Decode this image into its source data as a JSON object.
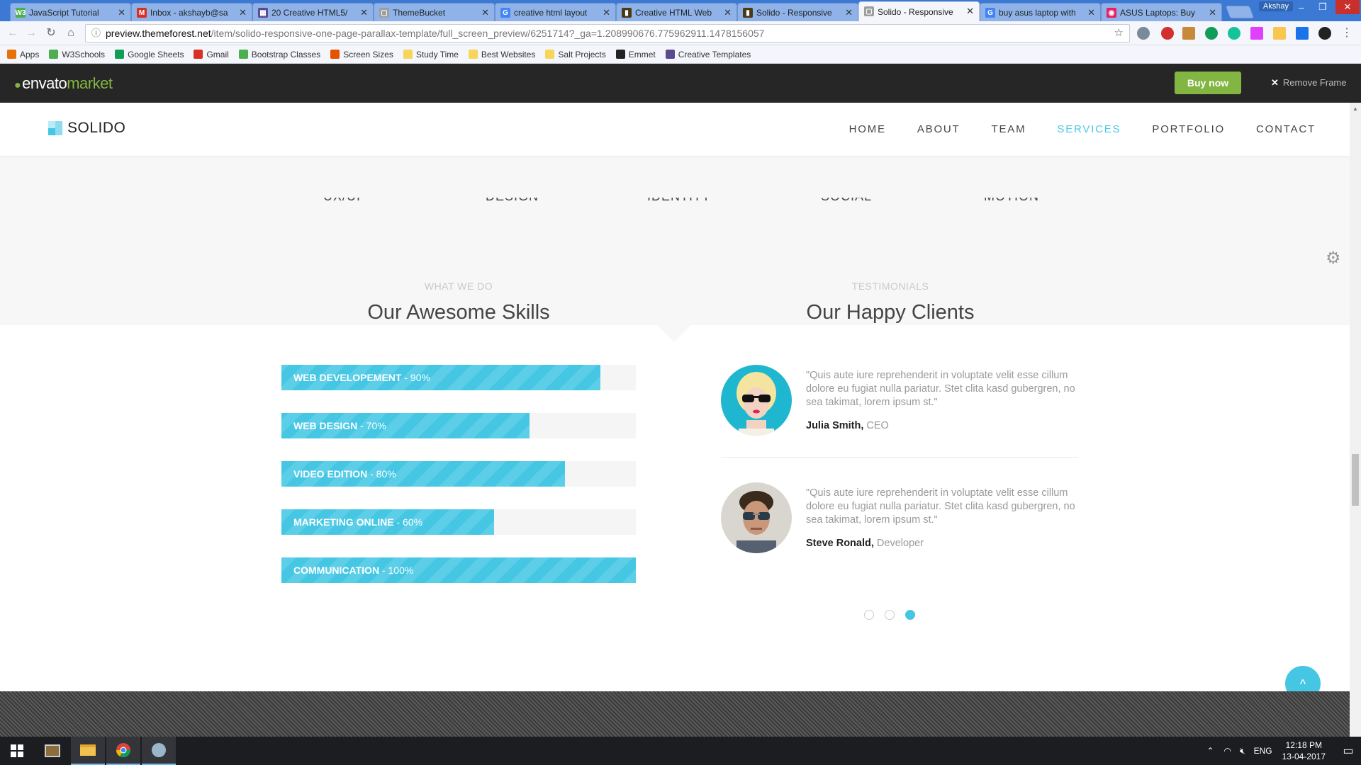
{
  "browser": {
    "tabs": [
      {
        "title": "JavaScript Tutorial",
        "icon_color": "#4caf50",
        "icon_text": "W3",
        "active": false
      },
      {
        "title": "Inbox - akshayb@sa",
        "icon_color": "#d93025",
        "icon_text": "M",
        "active": false
      },
      {
        "title": "20 Creative HTML5/",
        "icon_color": "#5c4a8e",
        "icon_text": "▦",
        "active": false
      },
      {
        "title": "ThemeBucket",
        "icon_color": "#9e9e9e",
        "icon_text": "▢",
        "active": false
      },
      {
        "title": "creative html layout",
        "icon_color": "#4285f4",
        "icon_text": "G",
        "active": false
      },
      {
        "title": "Creative HTML Web",
        "icon_color": "#4a3b14",
        "icon_text": "▮",
        "active": false
      },
      {
        "title": "Solido - Responsive",
        "icon_color": "#4a3b14",
        "icon_text": "▮",
        "active": false
      },
      {
        "title": "Solido - Responsive",
        "icon_color": "#9e9e9e",
        "icon_text": "▢",
        "active": true
      },
      {
        "title": "buy asus laptop with",
        "icon_color": "#4285f4",
        "icon_text": "G",
        "active": false
      },
      {
        "title": "ASUS Laptops: Buy",
        "icon_color": "#e91e63",
        "icon_text": "◉",
        "active": false
      }
    ],
    "user": "Akshay",
    "url_domain": "preview.themeforest.net",
    "url_path": "/item/solido-responsive-one-page-parallax-template/full_screen_preview/6251714?_ga=1.208990676.775962911.1478156057",
    "bookmarks": [
      {
        "label": "Apps",
        "icon": "apps-grid-icon",
        "color": "#e8710a"
      },
      {
        "label": "W3Schools",
        "icon": "w3schools-icon",
        "color": "#4caf50"
      },
      {
        "label": "Google Sheets",
        "icon": "sheets-icon",
        "color": "#0f9d58"
      },
      {
        "label": "Gmail",
        "icon": "gmail-icon",
        "color": "#d93025"
      },
      {
        "label": "Bootstrap Classes",
        "icon": "w3schools-icon",
        "color": "#4caf50"
      },
      {
        "label": "Screen Sizes",
        "icon": "gear-icon",
        "color": "#e65100"
      },
      {
        "label": "Study Time",
        "icon": "folder-icon",
        "color": "#f7d55a"
      },
      {
        "label": "Best Websites",
        "icon": "folder-icon",
        "color": "#f7d55a"
      },
      {
        "label": "Salt Projects",
        "icon": "folder-icon",
        "color": "#f7d55a"
      },
      {
        "label": "Emmet",
        "icon": "emmet-icon",
        "color": "#222222"
      },
      {
        "label": "Creative Templates",
        "icon": "creative-icon",
        "color": "#5c4a8e"
      }
    ]
  },
  "envato": {
    "logo_main": "envato",
    "logo_accent": "market",
    "buy_now": "Buy now",
    "remove_frame": "Remove Frame"
  },
  "site": {
    "brand": "SOLIDO",
    "nav": [
      {
        "label": "HOME",
        "active": false
      },
      {
        "label": "ABOUT",
        "active": false
      },
      {
        "label": "TEAM",
        "active": false
      },
      {
        "label": "SERVICES",
        "active": true
      },
      {
        "label": "PORTFOLIO",
        "active": false
      },
      {
        "label": "CONTACT",
        "active": false
      }
    ],
    "service_labels": [
      "UX/UI",
      "DESIGN",
      "IDENTITY",
      "SOCIAL",
      "MOTION"
    ],
    "skills": {
      "eyebrow": "WHAT WE DO",
      "title": "Our Awesome Skills",
      "items": [
        {
          "name": "WEB DEVELOPEMENT",
          "percent_text": " - 90%",
          "value": 90
        },
        {
          "name": "WEB DESIGN",
          "percent_text": " - 70%",
          "value": 70
        },
        {
          "name": "VIDEO EDITION",
          "percent_text": " - 80%",
          "value": 80
        },
        {
          "name": "MARKETING ONLINE",
          "percent_text": " - 60%",
          "value": 60
        },
        {
          "name": "COMMUNICATION",
          "percent_text": " - 100%",
          "value": 100
        }
      ]
    },
    "testimonials": {
      "eyebrow": "TESTIMONIALS",
      "title": "Our Happy Clients",
      "items": [
        {
          "quote": "\"Quis aute iure reprehenderit in voluptate velit esse cillum dolore eu fugiat nulla pariatur. Stet clita kasd gubergren, no sea takimat, lorem ipsum st.\"",
          "name": "Julia Smith,",
          "role": " CEO"
        },
        {
          "quote": "\"Quis aute iure reprehenderit in voluptate velit esse cillum dolore eu fugiat nulla pariatur. Stet clita kasd gubergren, no sea takimat, lorem ipsum st.\"",
          "name": "Steve Ronald,",
          "role": " Developer"
        }
      ],
      "pager_count": 3,
      "pager_active": 3
    },
    "accent_color": "#45c7e4"
  },
  "taskbar": {
    "lang": "ENG",
    "time": "12:18 PM",
    "date": "13-04-2017"
  }
}
